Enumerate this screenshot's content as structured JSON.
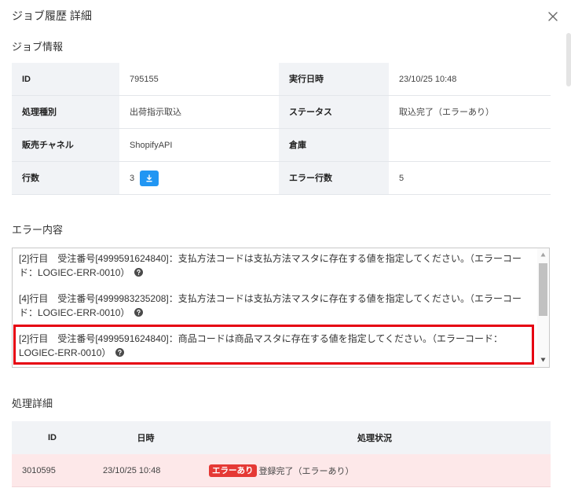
{
  "dialog": {
    "title": "ジョブ履歴 詳細"
  },
  "icons": {
    "close": "close-icon",
    "download": "download-icon",
    "help": "question-circle-icon",
    "scroll_up": "triangle-up-icon",
    "scroll_down": "triangle-down-icon"
  },
  "colors": {
    "accent": "#2196f3",
    "label_bg": "#f1f3f6",
    "error_badge": "#e53935",
    "error_row_bg": "#fde8e9",
    "annotation": "#e60012"
  },
  "job_info": {
    "heading": "ジョブ情報",
    "rows": [
      [
        {
          "label": "ID",
          "value": "795155"
        },
        {
          "label": "実行日時",
          "value": "23/10/25 10:48"
        }
      ],
      [
        {
          "label": "処理種別",
          "value": "出荷指示取込"
        },
        {
          "label": "ステータス",
          "value": "取込完了（エラーあり）"
        }
      ],
      [
        {
          "label": "販売チャネル",
          "value": "ShopifyAPI"
        },
        {
          "label": "倉庫",
          "value": ""
        }
      ],
      [
        {
          "label": "行数",
          "value": "3"
        },
        {
          "label": "エラー行数",
          "value": "5"
        }
      ]
    ]
  },
  "errors": {
    "heading": "エラー内容",
    "items": [
      {
        "text": "[2]行目　受注番号[4999591624840]：支払方法コードは支払方法マスタに存在する値を指定してください。（エラーコード：LOGIEC-ERR-0010）",
        "highlighted": false
      },
      {
        "text": "[4]行目　受注番号[4999983235208]：支払方法コードは支払方法マスタに存在する値を指定してください。（エラーコード：LOGIEC-ERR-0010）",
        "highlighted": false
      },
      {
        "text": "[2]行目　受注番号[4999591624840]：商品コードは商品マスタに存在する値を指定してください。（エラーコード：LOGIEC-ERR-0010）",
        "highlighted": true
      }
    ]
  },
  "details": {
    "heading": "処理詳細",
    "columns": [
      "ID",
      "日時",
      "処理状況"
    ],
    "rows": [
      {
        "id": "3010595",
        "datetime": "23/10/25 10:48",
        "badge": "エラーあり",
        "status": "登録完了（エラーあり）"
      }
    ]
  }
}
